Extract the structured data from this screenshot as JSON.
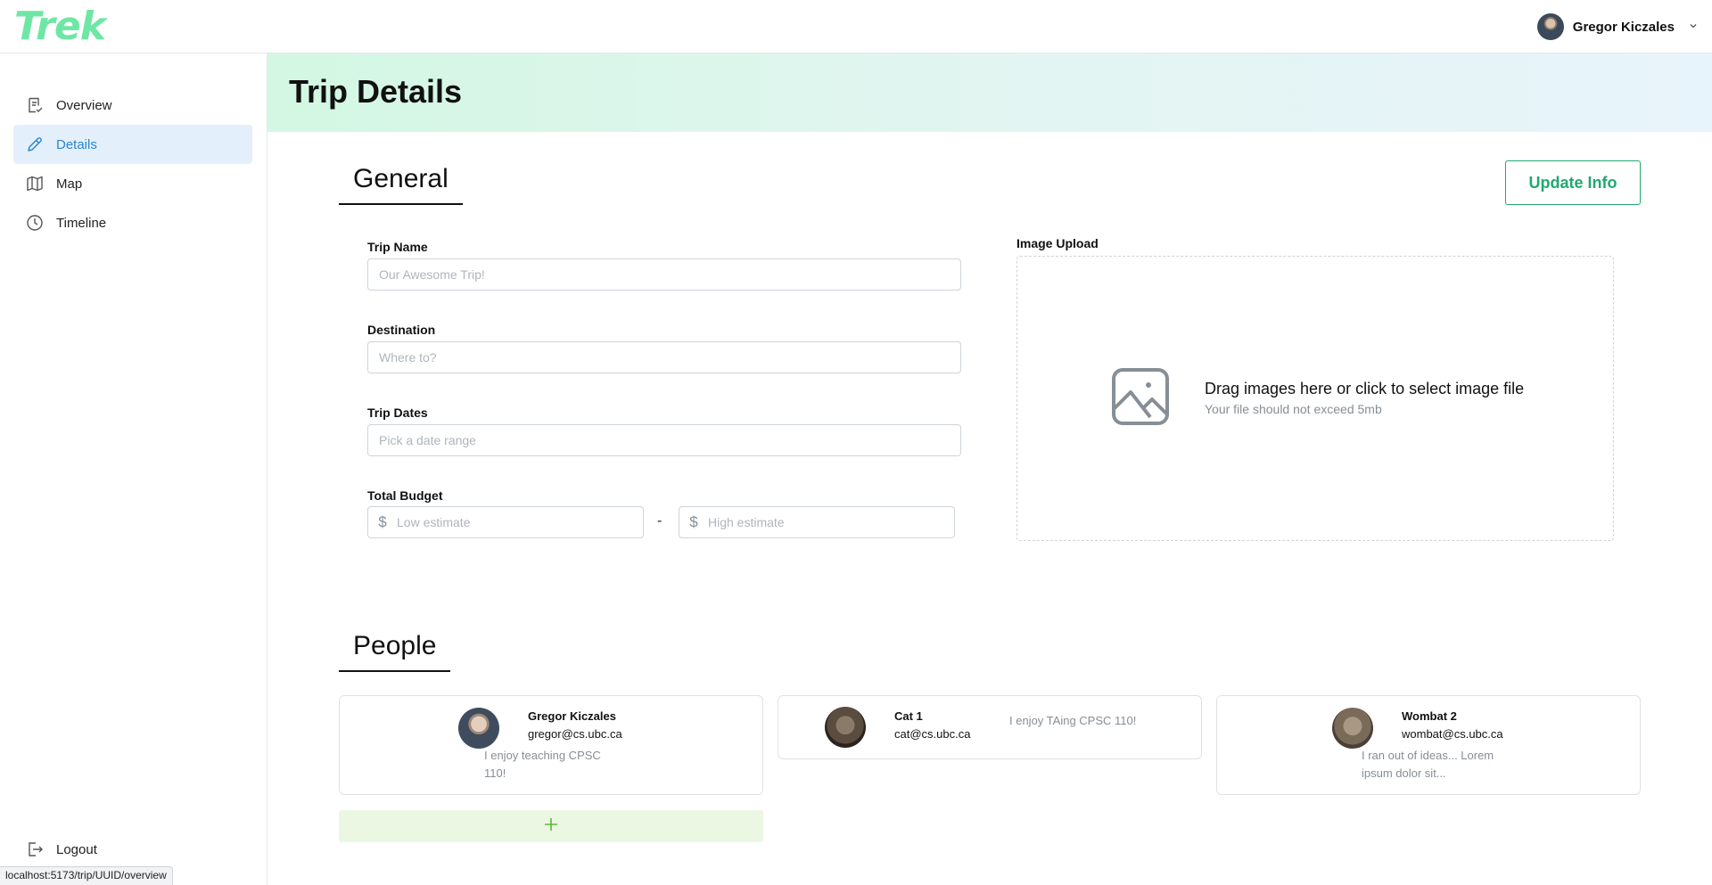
{
  "app": {
    "logo": "Trek"
  },
  "header": {
    "user_name": "Gregor Kiczales"
  },
  "sidebar": {
    "items": [
      {
        "label": "Overview",
        "icon": "overview-checklist-icon",
        "active": false
      },
      {
        "label": "Details",
        "icon": "pencil-icon",
        "active": true
      },
      {
        "label": "Map",
        "icon": "map-icon",
        "active": false
      },
      {
        "label": "Timeline",
        "icon": "clock-icon",
        "active": false
      }
    ],
    "logout_label": "Logout"
  },
  "status_bar": {
    "url": "localhost:5173/trip/UUID/overview"
  },
  "page": {
    "title": "Trip Details"
  },
  "general": {
    "heading": "General",
    "update_button": "Update Info",
    "trip_name": {
      "label": "Trip Name",
      "placeholder": "Our Awesome Trip!",
      "value": ""
    },
    "destination": {
      "label": "Destination",
      "placeholder": "Where to?",
      "value": ""
    },
    "trip_dates": {
      "label": "Trip Dates",
      "placeholder": "Pick a date range",
      "value": ""
    },
    "budget": {
      "label": "Total Budget",
      "currency_symbol": "$",
      "low_placeholder": "Low estimate",
      "high_placeholder": "High estimate",
      "separator": "-"
    },
    "image_upload": {
      "label": "Image Upload",
      "title": "Drag images here or click to select image file",
      "subtitle": "Your file should not exceed 5mb"
    }
  },
  "people": {
    "heading": "People",
    "members": [
      {
        "name": "Gregor Kiczales",
        "email": "gregor@cs.ubc.ca",
        "bio": "I enjoy teaching CPSC 110!"
      },
      {
        "name": "Cat 1",
        "email": "cat@cs.ubc.ca",
        "bio": "I enjoy TAing CPSC 110!"
      },
      {
        "name": "Wombat 2",
        "email": "wombat@cs.ubc.ca",
        "bio": "I ran out of ideas... Lorem ipsum dolor sit..."
      }
    ],
    "add_icon": "plus-icon"
  },
  "colors": {
    "logo": "#6ee7a4",
    "accent_green": "#20a870",
    "active_nav_bg": "#e3f0fb",
    "active_nav_text": "#2a86d1",
    "add_person_bg": "#ebf7e3"
  }
}
